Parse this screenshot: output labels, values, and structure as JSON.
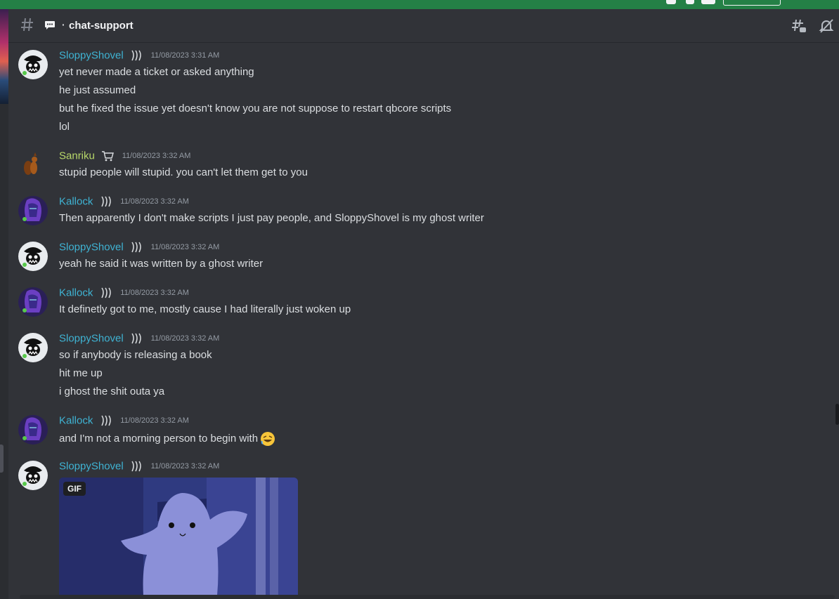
{
  "header": {
    "channel_name": "chat-support"
  },
  "messages": [
    {
      "author": "SloppyShovel",
      "timestamp": "11/08/2023 3:31 AM",
      "lines": [
        "yet never made a ticket or asked anything",
        "he just assumed",
        "but he fixed the issue yet doesn't know you are not suppose to restart qbcore scripts",
        "lol"
      ]
    },
    {
      "author": "Sanriku",
      "timestamp": "11/08/2023 3:32 AM",
      "lines": [
        "stupid people will stupid. you can't let them get to you"
      ]
    },
    {
      "author": "Kallock",
      "timestamp": "11/08/2023 3:32 AM",
      "lines": [
        "Then apparently I don't make scripts I just pay people, and SloppyShovel is my ghost writer"
      ]
    },
    {
      "author": "SloppyShovel",
      "timestamp": "11/08/2023 3:32 AM",
      "lines": [
        "yeah he said it was written by a ghost writer"
      ]
    },
    {
      "author": "Kallock",
      "timestamp": "11/08/2023 3:32 AM",
      "lines": [
        "It definetly got to me, mostly cause I had literally just woken up"
      ]
    },
    {
      "author": "SloppyShovel",
      "timestamp": "11/08/2023 3:32 AM",
      "lines": [
        "so if anybody is releasing a book",
        "hit me up",
        "i ghost the shit outa ya"
      ]
    },
    {
      "author": "Kallock",
      "timestamp": "11/08/2023 3:32 AM",
      "lines": [
        "and I'm not a morning person to begin with"
      ]
    },
    {
      "author": "SloppyShovel",
      "timestamp": "11/08/2023 3:32 AM",
      "lines": [],
      "attachment": {
        "badge": "GIF"
      }
    }
  ],
  "colors": {
    "accent_blue_name": "#3fb3d3",
    "accent_green_name": "#b8d86a",
    "background": "#313338",
    "banner": "#248046"
  },
  "icons": {
    "header": [
      "hash-icon",
      "speech-bubble-icon",
      "threads-icon",
      "mute-bell-icon"
    ],
    "role_tag": "wave-tag-icon",
    "sanriku_tag": "cart-icon",
    "emoji": "rofl-emoji"
  }
}
